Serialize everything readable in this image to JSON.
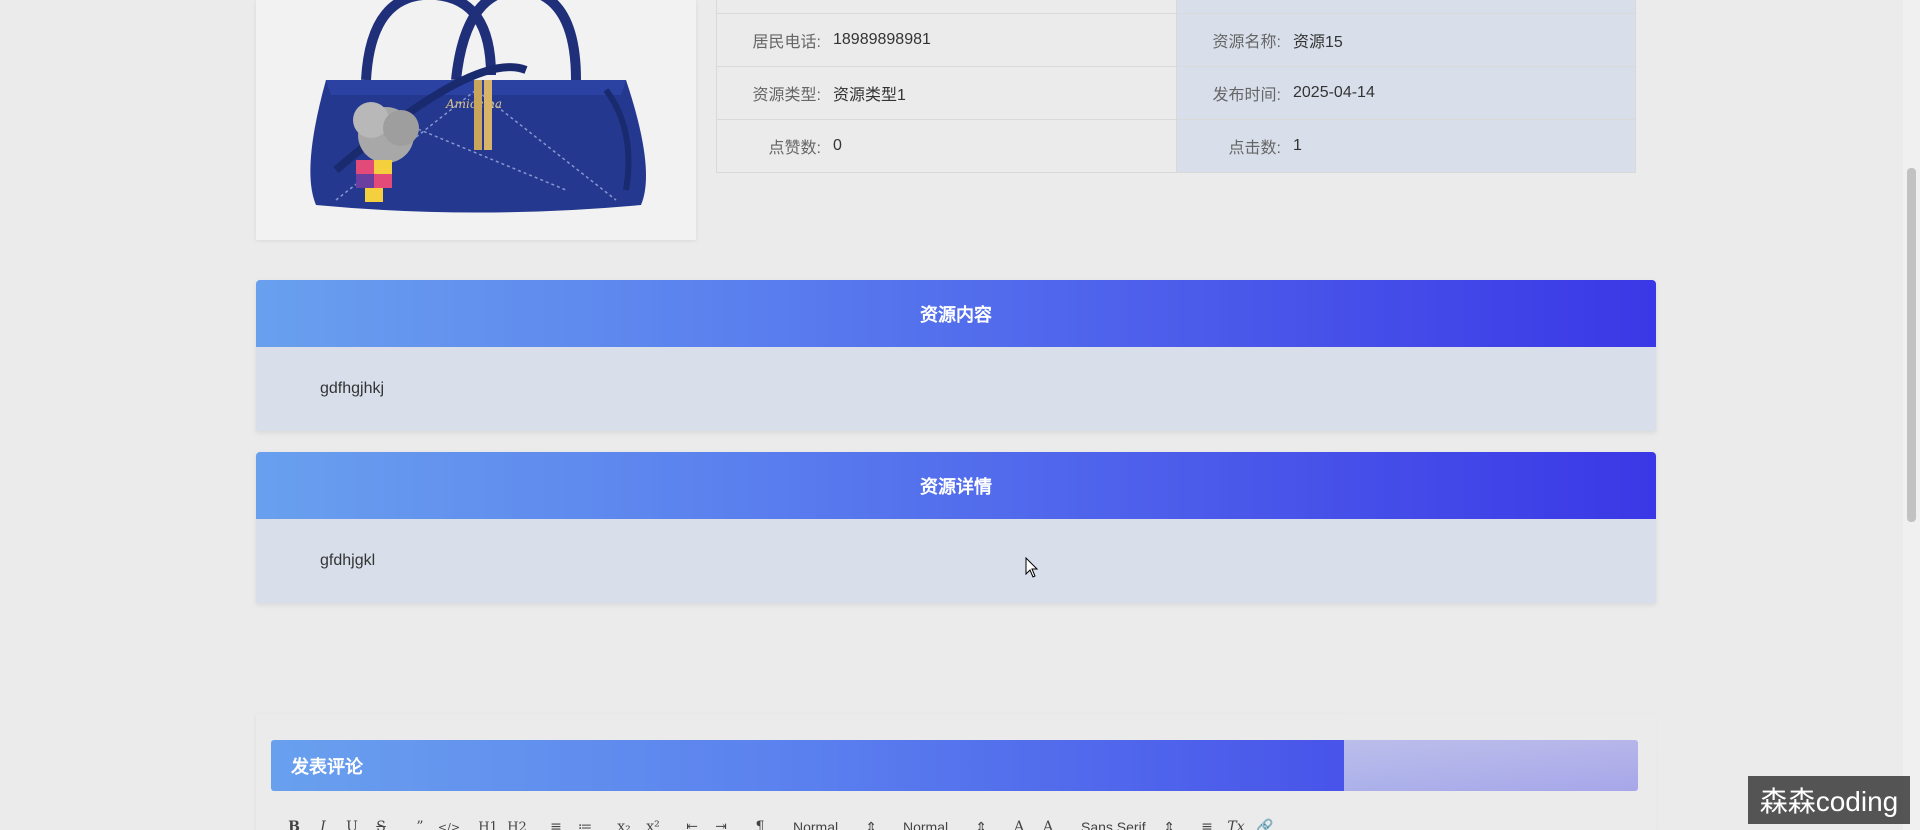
{
  "info": {
    "rows": [
      {
        "left_label": "居民电话:",
        "left_value": "18989898981",
        "right_label": "资源名称:",
        "right_value": "资源15"
      },
      {
        "left_label": "资源类型:",
        "left_value": "资源类型1",
        "right_label": "发布时间:",
        "right_value": "2025-04-14"
      },
      {
        "left_label": "点赞数:",
        "left_value": "0",
        "right_label": "点击数:",
        "right_value": "1"
      }
    ]
  },
  "sections": [
    {
      "title": "资源内容",
      "body": "gdfhgjhkj"
    },
    {
      "title": "资源详情",
      "body": "gfdhjgkl"
    }
  ],
  "comment": {
    "title": "发表评论",
    "toolbar": {
      "bold": "B",
      "italic": "I",
      "underline": "U",
      "strike": "S",
      "quote": "”",
      "code": "</>",
      "h1": "H1",
      "h2": "H2",
      "ordered": "≡",
      "bullet": "≔",
      "sub": "x₂",
      "sup": "x²",
      "outdent": "⇤",
      "indent": "⇥",
      "direction": "¶",
      "size_value": "Normal",
      "header_value": "Normal",
      "color": "A",
      "background": "A",
      "font_value": "Sans Serif",
      "align": "≡",
      "clean": "Tx",
      "link": "🔗"
    }
  },
  "watermark": "森森coding",
  "colors": {
    "accent_start": "#69a0ee",
    "accent_end": "#3a38e6",
    "panel": "#d8dfeb"
  }
}
